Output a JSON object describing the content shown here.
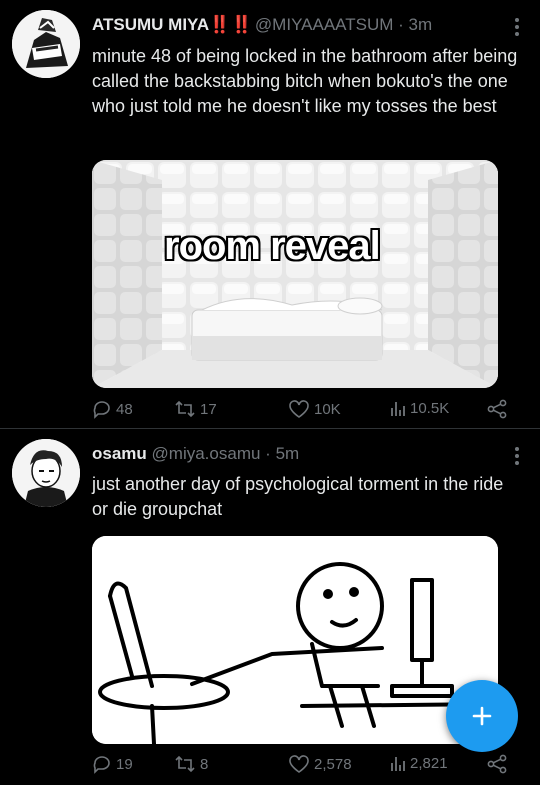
{
  "tweets": [
    {
      "name": "ATSUMU MIYA",
      "name_emoji": "‼️ ‼️",
      "handle": "@MIYAAAATSUM",
      "separator": "·",
      "time": "3m",
      "text": "minute 48 of being locked in the bathroom after being called the backstabbing bitch when bokuto's the one who just told me he doesn't like my tosses the best",
      "media_caption": "room reveal",
      "actions": {
        "replies": "48",
        "retweets": "17",
        "likes": "10K",
        "views": "10.5K"
      }
    },
    {
      "name": "osamu",
      "handle": "@miya.osamu",
      "separator": "·",
      "time": "5m",
      "text": "just another day of psychological torment in the ride or die groupchat",
      "actions": {
        "replies": "19",
        "retweets": "8",
        "likes": "2,578",
        "views": "2,821"
      }
    }
  ],
  "fab": {
    "icon": "plus-icon"
  },
  "colors": {
    "background": "#000000",
    "accent": "#1d9bf0",
    "muted": "#71767b",
    "text": "#e7e9ea"
  }
}
